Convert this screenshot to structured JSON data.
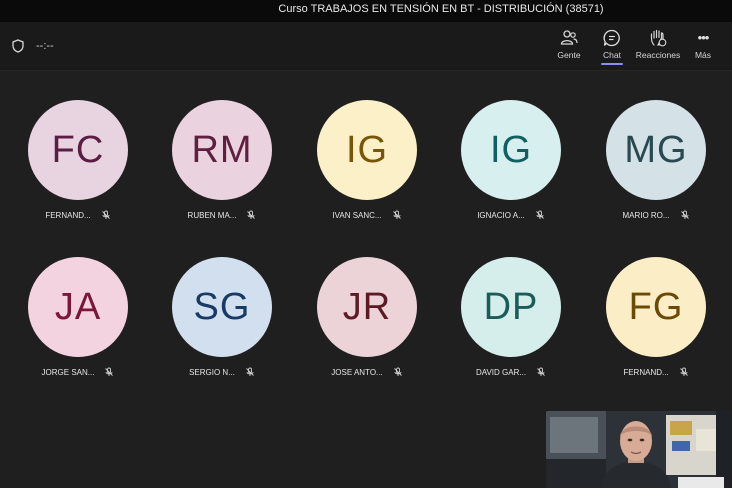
{
  "window": {
    "title": "Curso TRABAJOS EN TENSIÓN EN BT - DISTRIBUCIÓN (38571)"
  },
  "toolbar": {
    "timer": "--:--",
    "people_label": "Gente",
    "chat_label": "Chat",
    "reactions_label": "Reacciones",
    "more_label": "Más",
    "more_icon": "•••"
  },
  "participants": [
    {
      "initials": "FC",
      "name": "FERNAND...",
      "bg": "#e8d3e0",
      "fg": "#5a1e45"
    },
    {
      "initials": "RM",
      "name": "RUBEN MA...",
      "bg": "#ead2de",
      "fg": "#5e1f40"
    },
    {
      "initials": "IG",
      "name": "IVAN SANC...",
      "bg": "#fcf0c9",
      "fg": "#7a5508"
    },
    {
      "initials": "IG",
      "name": "IGNACIO A...",
      "bg": "#d8efef",
      "fg": "#0f5f63"
    },
    {
      "initials": "MG",
      "name": "MARIO RO...",
      "bg": "#d4e1e6",
      "fg": "#28494f"
    },
    {
      "initials": "JA",
      "name": "JORGE SAN...",
      "bg": "#f3d3df",
      "fg": "#7a1638"
    },
    {
      "initials": "SG",
      "name": "SERGIO N...",
      "bg": "#d2dfee",
      "fg": "#173a66"
    },
    {
      "initials": "JR",
      "name": "JOSE ANTO...",
      "bg": "#ecd3d8",
      "fg": "#5e1a24"
    },
    {
      "initials": "DP",
      "name": "DAVID GAR...",
      "bg": "#d5eeec",
      "fg": "#1a5c59"
    },
    {
      "initials": "FG",
      "name": "FERNAND...",
      "bg": "#fbeec6",
      "fg": "#6b4a06"
    }
  ],
  "participant_muted_icon": "mic-off-icon",
  "self_view": {
    "type": "camera-feed"
  }
}
